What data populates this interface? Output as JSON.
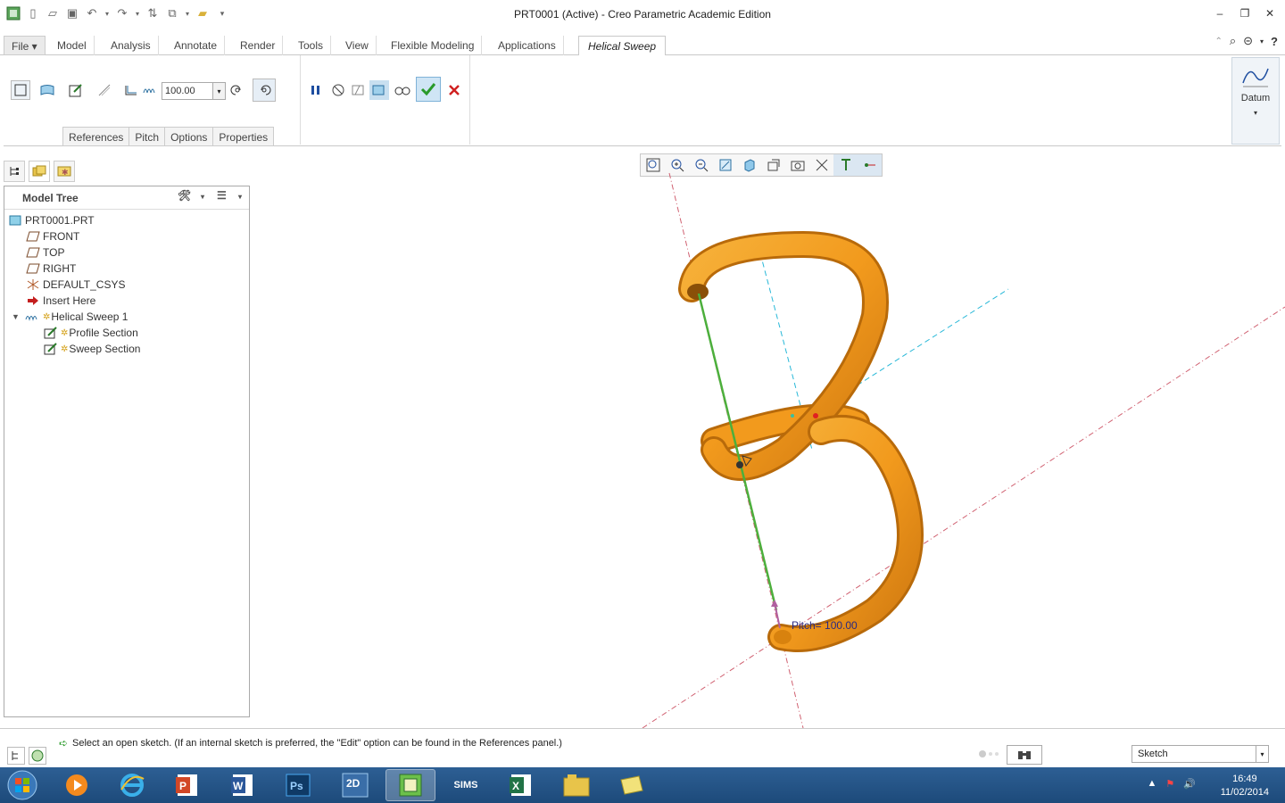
{
  "window": {
    "title": "PRT0001 (Active) - Creo Parametric Academic Edition"
  },
  "menu_tabs": [
    {
      "label": "File"
    },
    {
      "label": "Model"
    },
    {
      "label": "Analysis"
    },
    {
      "label": "Annotate"
    },
    {
      "label": "Render"
    },
    {
      "label": "Tools"
    },
    {
      "label": "View"
    },
    {
      "label": "Flexible Modeling"
    },
    {
      "label": "Applications"
    },
    {
      "label": "Helical Sweep"
    }
  ],
  "ribbon": {
    "pitch_value": "100.00",
    "sub_tabs": [
      "References",
      "Pitch",
      "Options",
      "Properties"
    ],
    "datum_label": "Datum"
  },
  "model_tree": {
    "title": "Model Tree",
    "items": [
      {
        "label": "PRT0001.PRT",
        "icon": "part-icon"
      },
      {
        "label": "FRONT",
        "icon": "datum-plane-icon"
      },
      {
        "label": "TOP",
        "icon": "datum-plane-icon"
      },
      {
        "label": "RIGHT",
        "icon": "datum-plane-icon"
      },
      {
        "label": "DEFAULT_CSYS",
        "icon": "csys-icon"
      },
      {
        "label": "Insert Here",
        "icon": "insert-arrow-icon"
      },
      {
        "label": "Helical Sweep 1",
        "icon": "helical-sweep-icon"
      },
      {
        "label": "Profile Section",
        "icon": "sketch-icon"
      },
      {
        "label": "Sweep Section",
        "icon": "sketch-icon"
      }
    ]
  },
  "viewport": {
    "pitch_annotation": "Pitch= 100.00"
  },
  "status": {
    "message": "Select an open sketch. (If an internal sketch is preferred, the \"Edit\" option can be found in the References panel.)",
    "selection_filter": "Sketch"
  },
  "taskbar": {
    "sims_label": "SIMS",
    "time": "16:49",
    "date": "11/02/2014"
  },
  "colors": {
    "spring": "#f29a1d",
    "spring_dark": "#c9700a",
    "axis_green": "#4caf3c",
    "accent_blue": "#1e4ea0"
  }
}
